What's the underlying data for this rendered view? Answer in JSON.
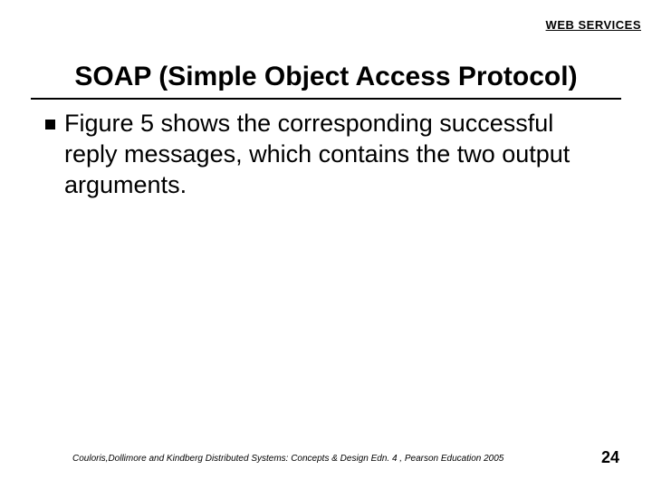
{
  "header": {
    "label": "WEB SERVICES"
  },
  "title": "SOAP (Simple Object Access Protocol)",
  "content": {
    "bullets": [
      "Figure 5 shows the corresponding successful reply messages, which contains the two output arguments."
    ]
  },
  "footer": {
    "citation": "Couloris,Dollimore and Kindberg  Distributed Systems: Concepts & Design  Edn. 4 , Pearson Education 2005",
    "page_number": "24"
  }
}
